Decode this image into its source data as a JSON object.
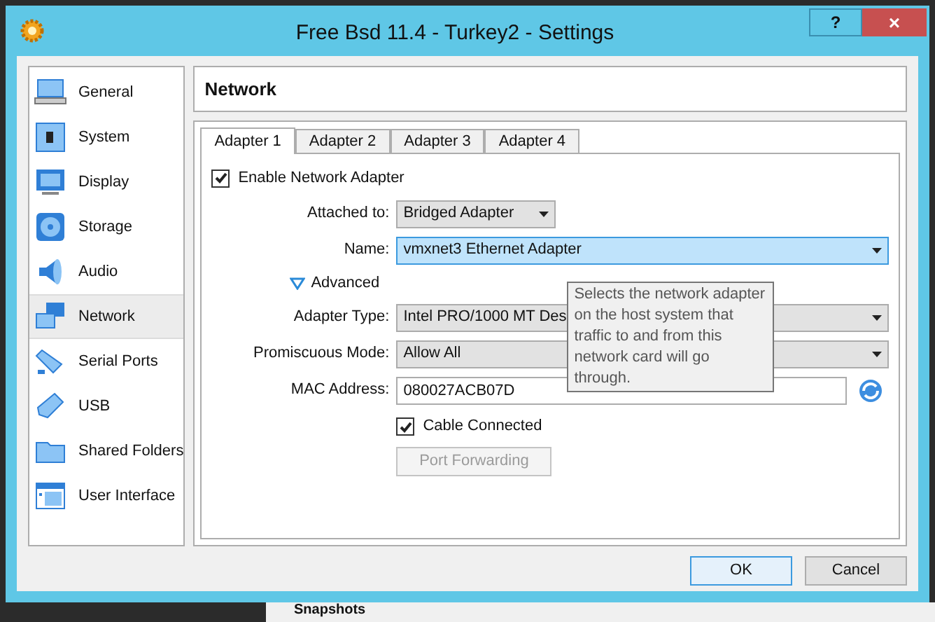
{
  "window": {
    "title": "Free Bsd 11.4 - Turkey2 - Settings",
    "help_label": "?",
    "close_label": "×"
  },
  "sidebar": {
    "items": [
      {
        "label": "General",
        "selected": false
      },
      {
        "label": "System",
        "selected": false
      },
      {
        "label": "Display",
        "selected": false
      },
      {
        "label": "Storage",
        "selected": false
      },
      {
        "label": "Audio",
        "selected": false
      },
      {
        "label": "Network",
        "selected": true
      },
      {
        "label": "Serial Ports",
        "selected": false
      },
      {
        "label": "USB",
        "selected": false
      },
      {
        "label": "Shared Folders",
        "selected": false
      },
      {
        "label": "User Interface",
        "selected": false
      }
    ]
  },
  "page_title": "Network",
  "tabs": [
    {
      "label": "Adapter 1",
      "selected": true
    },
    {
      "label": "Adapter 2",
      "selected": false
    },
    {
      "label": "Adapter 3",
      "selected": false
    },
    {
      "label": "Adapter 4",
      "selected": false
    }
  ],
  "enable_adapter": {
    "label": "Enable Network Adapter",
    "checked": true
  },
  "attached_to": {
    "label": "Attached to:",
    "value": "Bridged Adapter"
  },
  "name": {
    "label": "Name:",
    "value": "vmxnet3 Ethernet Adapter",
    "focused": true
  },
  "advanced": {
    "label": "Advanced",
    "expanded": true
  },
  "adapter_type": {
    "label": "Adapter Type:",
    "value": "Intel PRO/1000 MT Des"
  },
  "promiscuous_mode": {
    "label": "Promiscuous Mode:",
    "value": "Allow All"
  },
  "mac_address": {
    "label": "MAC Address:",
    "value": "080027ACB07D"
  },
  "cable_connected": {
    "label": "Cable Connected",
    "checked": true
  },
  "port_forwarding": {
    "label": "Port Forwarding",
    "disabled": true
  },
  "tooltip": "Selects the network adapter on the host system that traffic to and from this network card will go through.",
  "buttons": [
    {
      "label": "OK",
      "default": true
    },
    {
      "label": "Cancel",
      "default": false
    }
  ],
  "background_text": "Snapshots"
}
